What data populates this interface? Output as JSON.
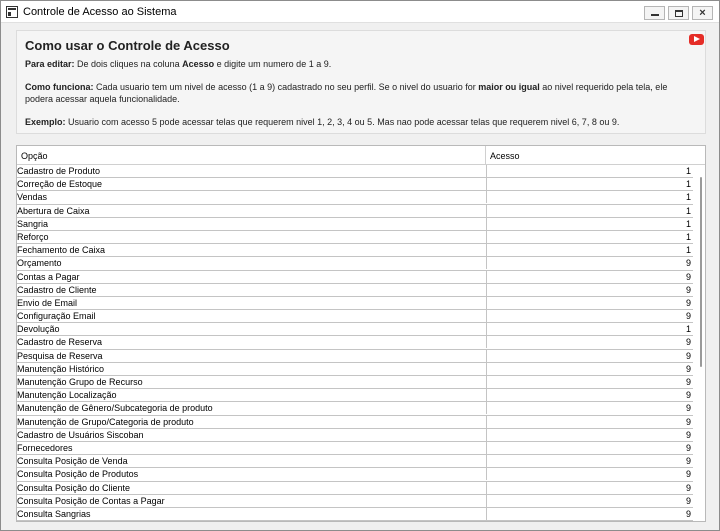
{
  "window": {
    "title": "Controle de Acesso ao Sistema",
    "close_glyph": "×"
  },
  "help": {
    "title": "Como usar o Controle de Acesso",
    "edit_label": "Para editar:",
    "edit_text_1": " De dois cliques na coluna ",
    "edit_bold": "Acesso",
    "edit_text_2": " e digite um numero de 1 a 9.",
    "how_label": "Como funciona:",
    "how_text_1": " Cada usuario tem um nivel de acesso (1 a 9) cadastrado no seu perfil. Se o nivel do usuario for ",
    "how_bold": "maior ou igual",
    "how_text_2": " ao nivel requerido pela tela, ele",
    "how_text_3": "podera acessar aquela funcionalidade.",
    "example_label": "Exemplo:",
    "example_text": " Usuario com acesso 5 pode acessar telas que requerem nivel 1, 2, 3, 4 ou 5. Mas nao pode acessar telas que requerem nivel 6, 7, 8 ou 9.",
    "video_icon": "youtube-play-icon",
    "video_color": "#e52d27"
  },
  "grid": {
    "columns": {
      "opcao": "Opção",
      "acesso": "Acesso"
    },
    "rows": [
      {
        "opcao": "Cadastro de Produto",
        "acesso": "1"
      },
      {
        "opcao": "Correção de Estoque",
        "acesso": "1"
      },
      {
        "opcao": "Vendas",
        "acesso": "1"
      },
      {
        "opcao": "Abertura de Caixa",
        "acesso": "1"
      },
      {
        "opcao": "Sangria",
        "acesso": "1"
      },
      {
        "opcao": "Reforço",
        "acesso": "1"
      },
      {
        "opcao": "Fechamento de Caixa",
        "acesso": "1"
      },
      {
        "opcao": "Orçamento",
        "acesso": "9"
      },
      {
        "opcao": "Contas a Pagar",
        "acesso": "9"
      },
      {
        "opcao": "Cadastro de Cliente",
        "acesso": "9"
      },
      {
        "opcao": "Envio de Email",
        "acesso": "9"
      },
      {
        "opcao": "Configuração Email",
        "acesso": "9"
      },
      {
        "opcao": "Devolução",
        "acesso": "1"
      },
      {
        "opcao": "Cadastro de Reserva",
        "acesso": "9"
      },
      {
        "opcao": "Pesquisa de Reserva",
        "acesso": "9"
      },
      {
        "opcao": "Manutenção Histórico",
        "acesso": "9"
      },
      {
        "opcao": "Manutenção Grupo de Recurso",
        "acesso": "9"
      },
      {
        "opcao": "Manutenção Localização",
        "acesso": "9"
      },
      {
        "opcao": "Manutenção de Gênero/Subcategoria de produto",
        "acesso": "9"
      },
      {
        "opcao": "Manutenção de Grupo/Categoria de produto",
        "acesso": "9"
      },
      {
        "opcao": "Cadastro de Usuários Siscoban",
        "acesso": "9"
      },
      {
        "opcao": "Fornecedores",
        "acesso": "9"
      },
      {
        "opcao": "Consulta Posição de Venda",
        "acesso": "9"
      },
      {
        "opcao": "Consulta Posição de Produtos",
        "acesso": "9"
      },
      {
        "opcao": "Consulta Posição do Cliente",
        "acesso": "9"
      },
      {
        "opcao": "Consulta Posição de Contas a Pagar",
        "acesso": "9"
      },
      {
        "opcao": "Consulta Sangrias",
        "acesso": "9"
      }
    ]
  }
}
